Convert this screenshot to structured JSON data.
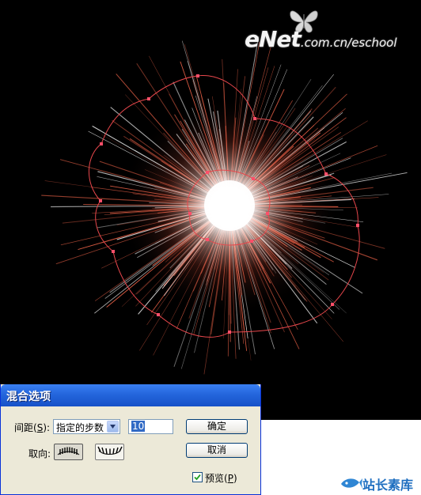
{
  "watermark": {
    "brand": "eNet",
    "url": ".com.cn/eschool"
  },
  "canvas": {
    "background": "#000000",
    "burst_color": "#ff6a4d",
    "path_color": "#e8474c",
    "anchor_color": "#ff4f6a"
  },
  "dialog": {
    "title": "混合选项",
    "spacing_label": "间距(",
    "spacing_mnemonic": "S",
    "spacing_label_tail": "):",
    "spacing_select_value": "指定的步数",
    "steps_value": "10",
    "orientation_label": "取向:",
    "ok_label": "确定",
    "cancel_label": "取消",
    "preview_label": "预览(",
    "preview_mnemonic": "P",
    "preview_label_tail": ")",
    "preview_checked": true
  },
  "footer_logo": {
    "text": "站长素库",
    "icon": "fish-logo-icon"
  }
}
